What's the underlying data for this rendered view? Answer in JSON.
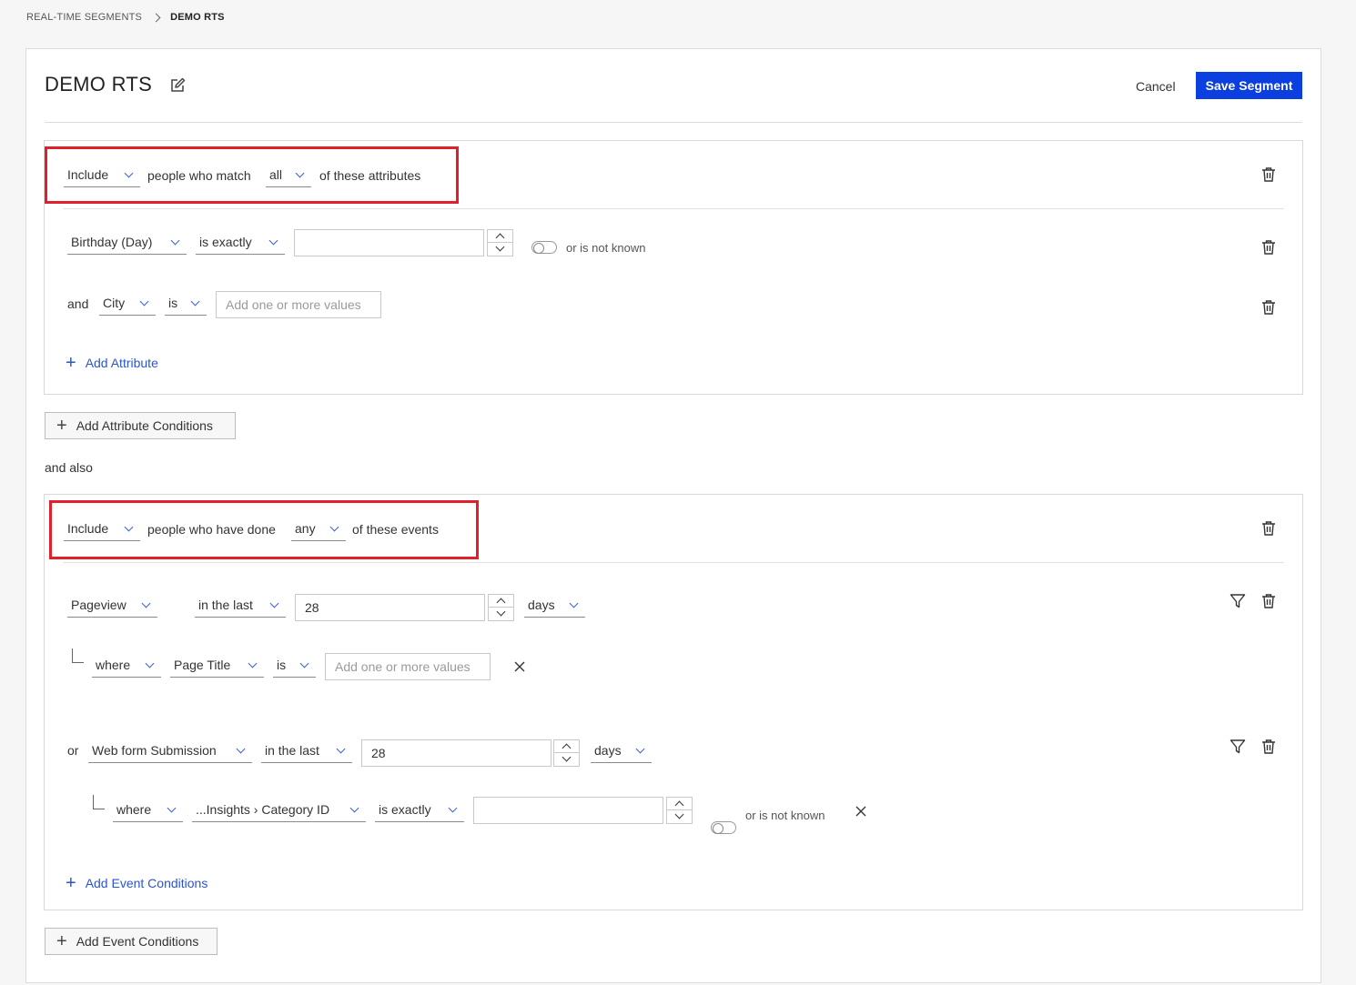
{
  "breadcrumb": {
    "parent": "REAL-TIME SEGMENTS",
    "current": "DEMO RTS"
  },
  "header": {
    "title": "DEMO RTS",
    "cancel": "Cancel",
    "save": "Save Segment"
  },
  "attr_group": {
    "mode": "Include",
    "text1": "people who match",
    "match": "all",
    "text2": "of these attributes",
    "rows": [
      {
        "field": "Birthday (Day)",
        "operator": "is exactly",
        "value": "",
        "not_known": "or is not known"
      },
      {
        "conj": "and",
        "field": "City",
        "operator": "is",
        "placeholder": "Add one or more values"
      }
    ],
    "add_attribute": "Add Attribute"
  },
  "add_attribute_conditions": "Add Attribute Conditions",
  "and_also": "and also",
  "event_group": {
    "mode": "Include",
    "text1": "people who have done",
    "match": "any",
    "text2": "of these events",
    "events": [
      {
        "event": "Pageview",
        "period": "in the last",
        "amount": "28",
        "unit": "days",
        "filter": {
          "where": "where",
          "field": "Page Title",
          "operator": "is",
          "placeholder": "Add one or more values"
        }
      },
      {
        "conj": "or",
        "event": "Web form Submission",
        "period": "in the last",
        "amount": "28",
        "unit": "days",
        "filter": {
          "where": "where",
          "field": "...Insights › Category ID",
          "operator": "is exactly",
          "value": "",
          "not_known": "or is not known"
        }
      }
    ],
    "add_event": "Add Event Conditions"
  },
  "add_event_conditions": "Add Event Conditions",
  "colors": {
    "primary": "#0b3fe0",
    "link": "#2b55cf",
    "highlight": "#e0202a"
  }
}
